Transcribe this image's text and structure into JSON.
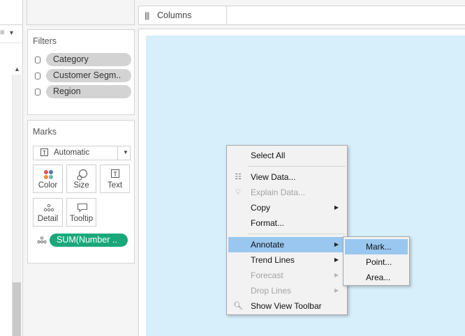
{
  "shelf": {
    "columns_label": "Columns"
  },
  "filters": {
    "title": "Filters",
    "items": [
      "Category",
      "Customer Segm..",
      "Region"
    ]
  },
  "marks": {
    "title": "Marks",
    "mark_type": "Automatic",
    "buttons": {
      "color": "Color",
      "size": "Size",
      "text": "Text",
      "detail": "Detail",
      "tooltip": "Tooltip"
    },
    "measure_pill": "SUM(Number .."
  },
  "context_menu": {
    "select_all": "Select All",
    "view_data": "View Data...",
    "explain_data": "Explain Data...",
    "copy": "Copy",
    "format": "Format...",
    "annotate": "Annotate",
    "trend_lines": "Trend Lines",
    "forecast": "Forecast",
    "drop_lines": "Drop Lines",
    "show_view_toolbar": "Show View Toolbar"
  },
  "annotate_submenu": {
    "mark": "Mark...",
    "point": "Point...",
    "area": "Area..."
  },
  "colors": {
    "canvas_bg": "#d7eefb",
    "pill_green": "#1aa87b",
    "highlight": "#99c7ef"
  }
}
